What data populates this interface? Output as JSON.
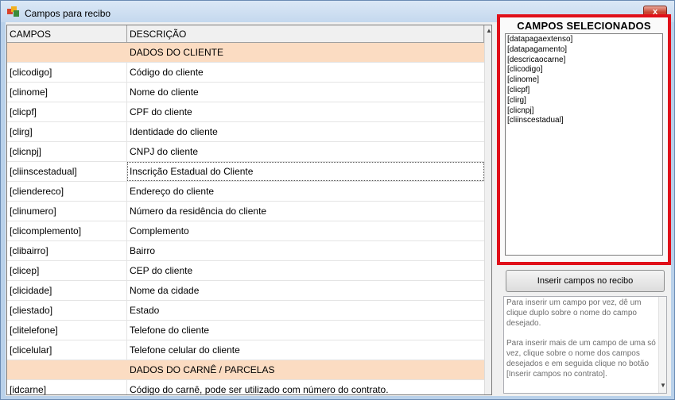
{
  "window": {
    "title": "Campos para recibo",
    "close_label": "x"
  },
  "grid": {
    "headers": [
      "CAMPOS",
      "DESCRIÇÃO"
    ],
    "rows": [
      {
        "field": "",
        "desc": "DADOS DO CLIENTE",
        "section": true
      },
      {
        "field": "[clicodigo]",
        "desc": "Código do cliente"
      },
      {
        "field": "[clinome]",
        "desc": "Nome do cliente"
      },
      {
        "field": "[clicpf]",
        "desc": "CPF do cliente"
      },
      {
        "field": "[clirg]",
        "desc": "Identidade do cliente"
      },
      {
        "field": "[clicnpj]",
        "desc": "CNPJ do cliente"
      },
      {
        "field": "[cliinscestadual]",
        "desc": "Inscrição Estadual do Cliente",
        "selected": true
      },
      {
        "field": "[cliendereco]",
        "desc": "Endereço do cliente"
      },
      {
        "field": "[clinumero]",
        "desc": "Número da residência do cliente"
      },
      {
        "field": "[clicomplemento]",
        "desc": "Complemento"
      },
      {
        "field": "[clibairro]",
        "desc": "Bairro"
      },
      {
        "field": "[clicep]",
        "desc": "CEP do cliente"
      },
      {
        "field": "[clicidade]",
        "desc": "Nome da cidade"
      },
      {
        "field": "[cliestado]",
        "desc": "Estado"
      },
      {
        "field": "[clitelefone]",
        "desc": "Telefone do cliente"
      },
      {
        "field": "[clicelular]",
        "desc": "Telefone celular do cliente"
      },
      {
        "field": "",
        "desc": "DADOS DO CARNÊ / PARCELAS",
        "section": true
      },
      {
        "field": "[idcarne]",
        "desc": "Código do carnê, pode ser utilizado com número do contrato."
      }
    ]
  },
  "selected_panel": {
    "title": "CAMPOS SELECIONADOS",
    "items": [
      "[datapagaextenso]",
      "[datapagamento]",
      "[descricaocarne]",
      "[clicodigo]",
      "[clinome]",
      "[clicpf]",
      "[clirg]",
      "[clicnpj]",
      "[cliinscestadual]"
    ]
  },
  "insert_button_label": "Inserir campos no recibo",
  "help": {
    "p1": "Para inserir um campo por vez, dê um clique duplo sobre o nome do campo desejado.",
    "p2": "Para inserir mais de um campo de uma só vez, clique sobre o nome dos campos desejados e em seguida clique no botão [Inserir campos no contrato]."
  },
  "colors": {
    "section_bg": "#fbdcc2",
    "highlight_border": "#e0101a"
  }
}
